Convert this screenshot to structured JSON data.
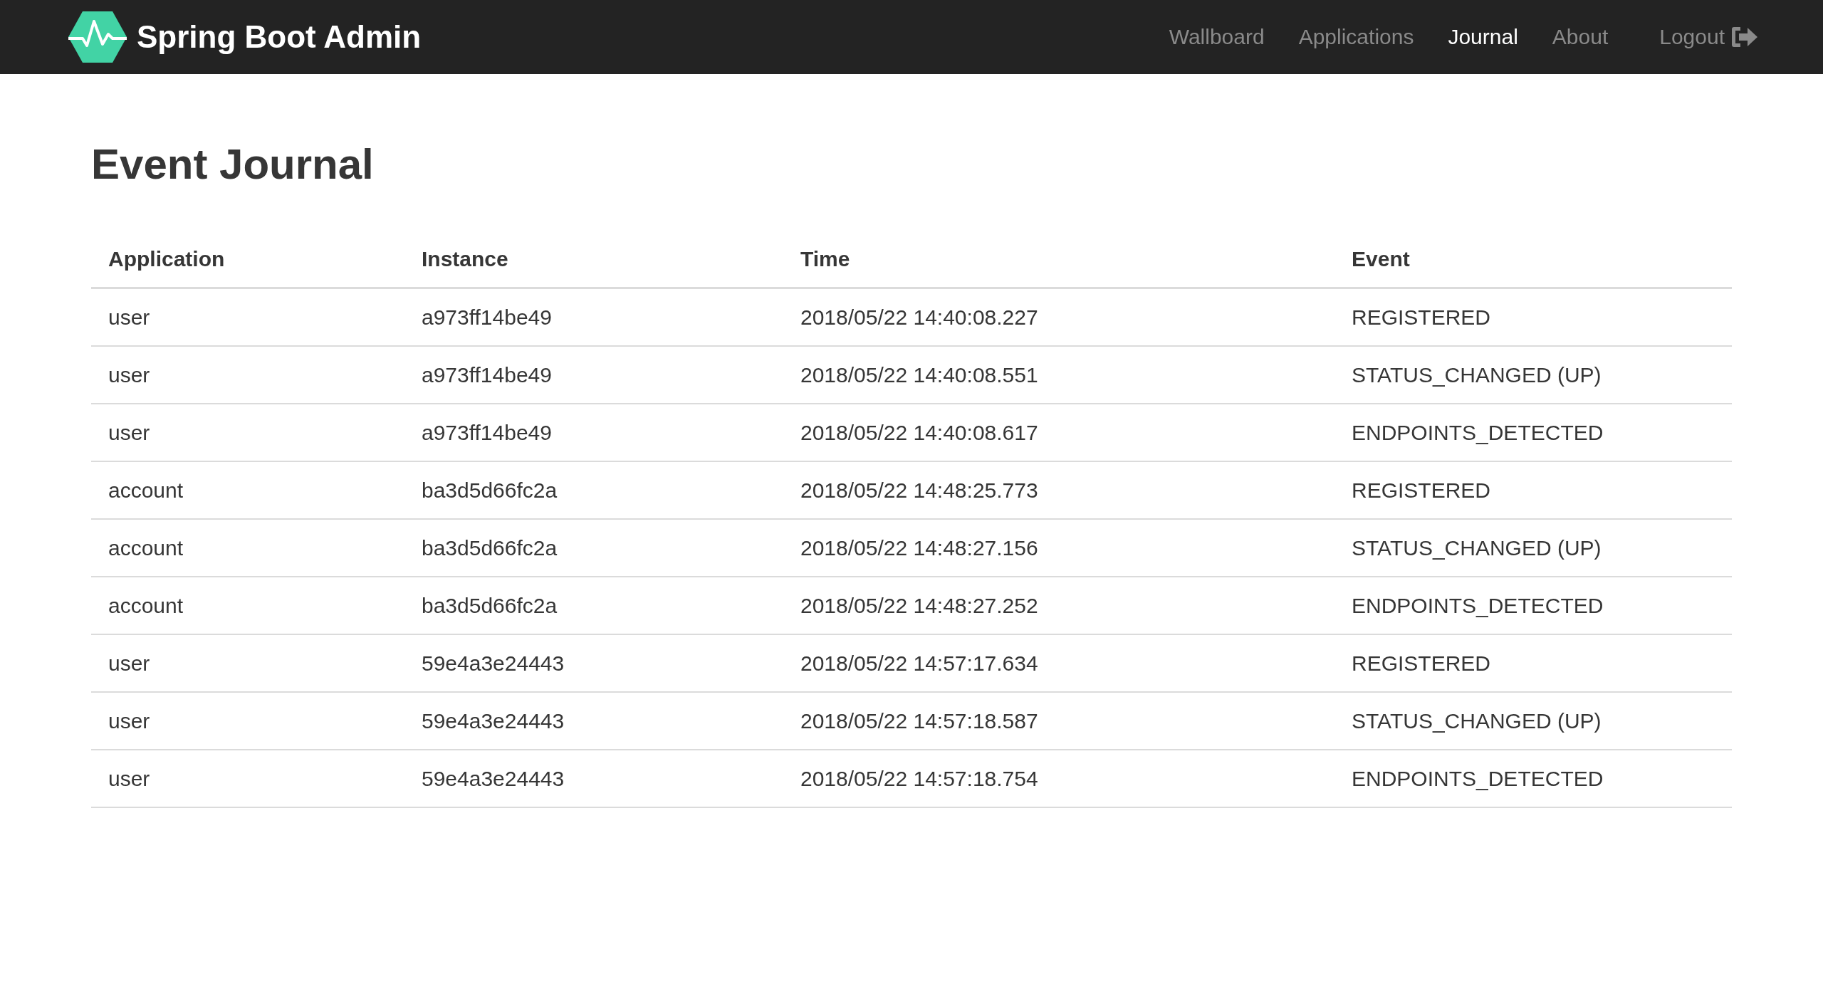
{
  "brand": "Spring Boot Admin",
  "nav": [
    {
      "label": "Wallboard",
      "selected": false
    },
    {
      "label": "Applications",
      "selected": false
    },
    {
      "label": "Journal",
      "selected": true
    },
    {
      "label": "About",
      "selected": false
    }
  ],
  "logout": "Logout",
  "heading": "Event Journal",
  "table": {
    "columns": [
      "Application",
      "Instance",
      "Time",
      "Event"
    ],
    "rows": [
      [
        "user",
        "a973ff14be49",
        "2018/05/22 14:40:08.227",
        "REGISTERED"
      ],
      [
        "user",
        "a973ff14be49",
        "2018/05/22 14:40:08.551",
        "STATUS_CHANGED (UP)"
      ],
      [
        "user",
        "a973ff14be49",
        "2018/05/22 14:40:08.617",
        "ENDPOINTS_DETECTED"
      ],
      [
        "account",
        "ba3d5d66fc2a",
        "2018/05/22 14:48:25.773",
        "REGISTERED"
      ],
      [
        "account",
        "ba3d5d66fc2a",
        "2018/05/22 14:48:27.156",
        "STATUS_CHANGED (UP)"
      ],
      [
        "account",
        "ba3d5d66fc2a",
        "2018/05/22 14:48:27.252",
        "ENDPOINTS_DETECTED"
      ],
      [
        "user",
        "59e4a3e24443",
        "2018/05/22 14:57:17.634",
        "REGISTERED"
      ],
      [
        "user",
        "59e4a3e24443",
        "2018/05/22 14:57:18.587",
        "STATUS_CHANGED (UP)"
      ],
      [
        "user",
        "59e4a3e24443",
        "2018/05/22 14:57:18.754",
        "ENDPOINTS_DETECTED"
      ]
    ]
  }
}
